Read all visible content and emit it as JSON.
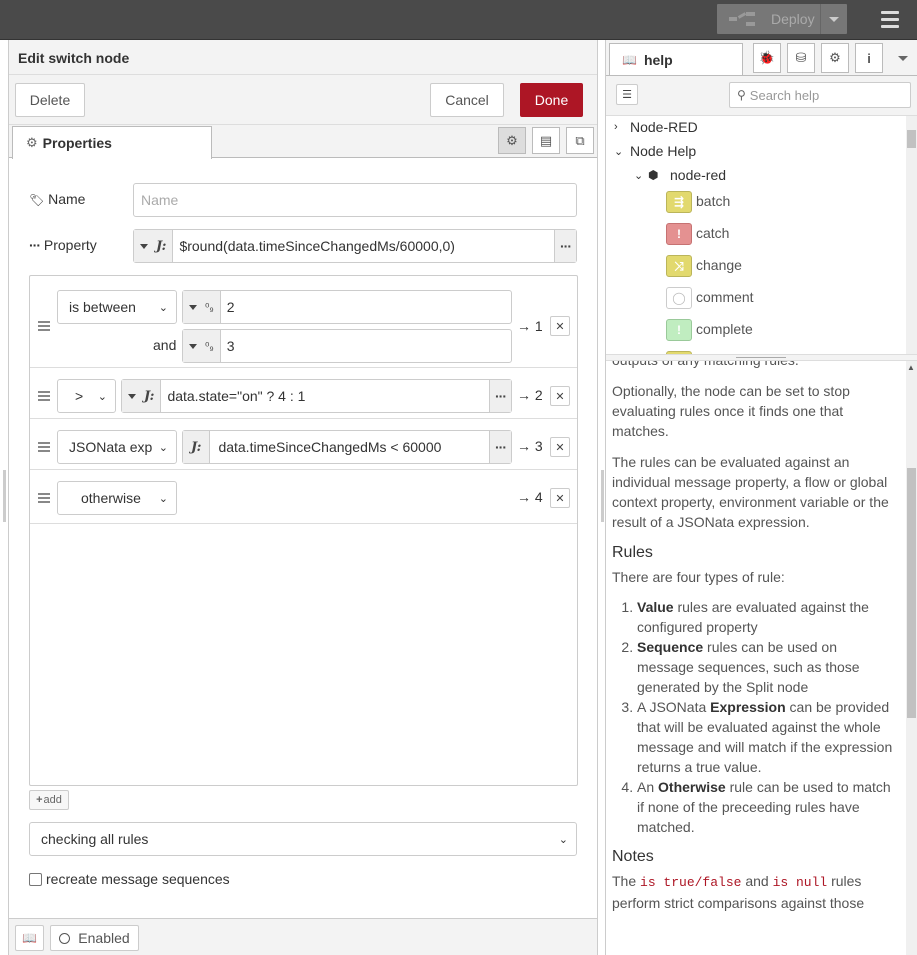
{
  "header": {
    "deploy_label": "Deploy"
  },
  "tray": {
    "title": "Edit switch node",
    "delete_label": "Delete",
    "cancel_label": "Cancel",
    "done_label": "Done",
    "tab_properties": "Properties",
    "name_label": "Name",
    "name_placeholder": "Name",
    "property_label": "Property",
    "property_value": "$round(data.timeSinceChangedMs/60000,0)",
    "rules": [
      {
        "operator": "is between",
        "value1": "2",
        "and_label": "and",
        "value2": "3",
        "output": "→ 1"
      },
      {
        "operator": ">",
        "value1": "data.state=\"on\" ? 4 : 1",
        "output": "→ 2"
      },
      {
        "operator": "JSONata exp",
        "value1": "data.timeSinceChangedMs < 60000",
        "output": "→ 3"
      },
      {
        "operator": "otherwise",
        "output": "→ 4"
      }
    ],
    "add_label": "add",
    "checking_mode": "checking all rules",
    "recreate_label": "recreate message sequences",
    "enabled_label": "Enabled"
  },
  "sidebar": {
    "tab_label": "help",
    "search_placeholder": "Search help",
    "tree": {
      "root1": "Node-RED",
      "root2": "Node Help",
      "group": "node-red",
      "nodes": [
        {
          "label": "batch",
          "color": "#e2d96e"
        },
        {
          "label": "catch",
          "color": "#e49191"
        },
        {
          "label": "change",
          "color": "#e2d96e"
        },
        {
          "label": "comment",
          "color": "#ffffff"
        },
        {
          "label": "complete",
          "color": "#c0edc0"
        }
      ]
    },
    "help": {
      "p_cutoff": "outputs of any matching rules.",
      "p1": "Optionally, the node can be set to stop evaluating rules once it finds one that matches.",
      "p2": "The rules can be evaluated against an individual message property, a flow or global context property, environment variable or the result of a JSONata expression.",
      "h_rules": "Rules",
      "p3": "There are four types of rule:",
      "li1_b": "Value",
      "li1": " rules are evaluated against the configured property",
      "li2_b": "Sequence",
      "li2": " rules can be used on message sequences, such as those generated by the Split node",
      "li3_a": "A JSONata ",
      "li3_b": "Expression",
      "li3": " can be provided that will be evaluated against the whole message and will match if the expression returns a true value.",
      "li4_a": "An ",
      "li4_b": "Otherwise",
      "li4": " rule can be used to match if none of the preceeding rules have matched.",
      "h_notes": "Notes",
      "p4_a": "The ",
      "p4_c1": "is true/false",
      "p4_b": " and ",
      "p4_c2": "is null",
      "p4_c": " rules perform strict comparisons against those types. They do not convert between types."
    }
  }
}
